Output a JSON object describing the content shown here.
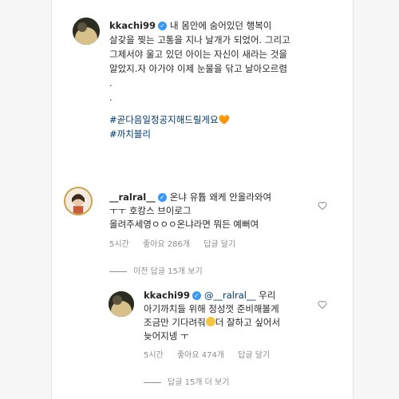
{
  "post": {
    "username": "kkachi99",
    "caption_line1": "내 몸안에 숨어있던 행복이",
    "caption_line2": "살갗을 찢는 고통을 지나 날개가 되었어. 그리고",
    "caption_line3": "그제서야 울고 있던 아이는 자신이 새라는 것을",
    "caption_line4": "알았지.자 아가야 이제 눈물을 닦고 날아오르렴",
    "dot1": ".",
    "dot2": ".",
    "hashtag1": "#곧다음일정공지해드릴게요",
    "hashtag1_emoji": "🧡",
    "hashtag2": "#까치블리"
  },
  "comment": {
    "username": "__ralral__",
    "line1": "온냐 유튭 왜케 안올라와여",
    "line2": "ㅜㅜ 호캉스 브이로그",
    "line3": "올려주세영ㅇㅇㅇ온냐라면 뭐든 예뻐여",
    "time": "5시간",
    "likes": "좋아요 286개",
    "reply": "답글 달기",
    "view_replies": "이전 답글 15개 보기"
  },
  "reply": {
    "username": "kkachi99",
    "mention": "@__ralral__",
    "line1_rest": "우리",
    "line2": "아기까치들 위해 정성껏 준비해볼게",
    "line3_a": "조금만 기다려줘",
    "line3_b": "더 잘하고 싶어서",
    "line4": "늦어지넹 ㅜ",
    "time": "5시간",
    "likes": "좋아요 474개",
    "reply": "답글 달기"
  },
  "footer": {
    "view_replies": "답글 15개 더 보기"
  },
  "colors": {
    "link": "#00376b",
    "meta": "#8e8e8e",
    "verified": "#3897f0"
  }
}
